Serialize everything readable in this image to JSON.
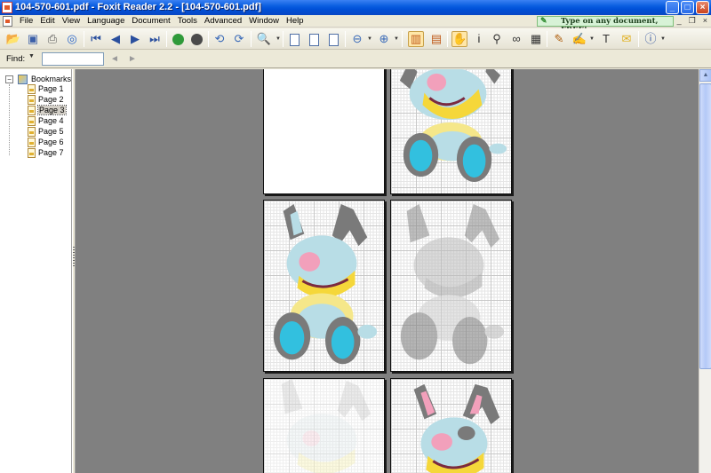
{
  "window": {
    "title": "104-570-601.pdf - Foxit Reader 2.2 - [104-570-601.pdf]",
    "controls": {
      "minimize": "_",
      "maximize": "□",
      "close": "×"
    },
    "mdi_controls": {
      "minimize": "_",
      "restore": "❐",
      "close": "×"
    }
  },
  "menu": {
    "items": [
      "File",
      "Edit",
      "View",
      "Language",
      "Document",
      "Tools",
      "Advanced",
      "Window",
      "Help"
    ],
    "promo": "Type on any document, FREE!"
  },
  "toolbar": {
    "buttons": [
      "open-folder",
      "save",
      "print",
      "email",
      "first-page",
      "previous-page",
      "next-page",
      "last-page",
      "go-back",
      "go-forward",
      "rotate-left",
      "rotate-right",
      "zoom",
      "actual-size",
      "fit-page",
      "fit-width",
      "zoom-out",
      "zoom-in",
      "continuous-facing",
      "single-page",
      "hand-tool",
      "select-text",
      "find",
      "snapshot",
      "typewriter",
      "highlight",
      "text-tool",
      "note",
      "info"
    ],
    "active": [
      "continuous-facing",
      "hand-tool"
    ]
  },
  "find": {
    "label": "Find:",
    "value": "",
    "placeholder": ""
  },
  "bookmarks": {
    "root_label": "Bookmarks",
    "root_toggle": "−",
    "items": [
      {
        "label": "Page 1"
      },
      {
        "label": "Page 2"
      },
      {
        "label": "Page 3",
        "selected": true
      },
      {
        "label": "Page 4"
      },
      {
        "label": "Page 5"
      },
      {
        "label": "Page 6"
      },
      {
        "label": "Page 7"
      }
    ]
  },
  "document": {
    "file_name": "104-570-601.pdf",
    "layout": "continuous facing",
    "visible_pages": 6
  },
  "colors": {
    "titlebar": "#0a5ee0",
    "doc_background": "#808080",
    "promo_background": "#d7f2d6",
    "bunny_gray": "#7a7a7a",
    "bunny_light_blue": "#b8dde6",
    "bunny_yellow": "#f5d73a",
    "bunny_pink": "#f2a0bb",
    "bunny_cyan": "#32c0df"
  }
}
